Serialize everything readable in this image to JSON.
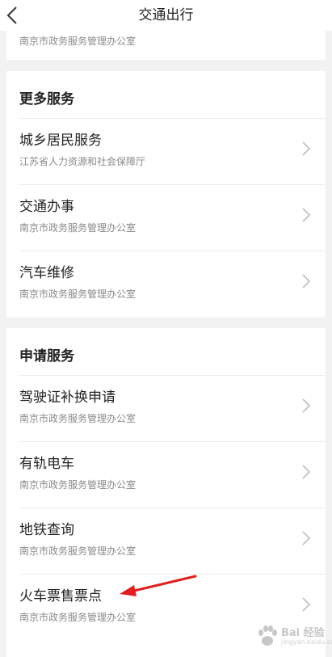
{
  "header": {
    "title": "交通出行",
    "back_icon": "chevron-left-icon"
  },
  "top_partial": {
    "subtitle": "南京市政务服务管理办公室"
  },
  "more_services": {
    "title": "更多服务",
    "items": [
      {
        "name": "城乡居民服务",
        "org": "江苏省人力资源和社会保障厅"
      },
      {
        "name": "交通办事",
        "org": "南京市政务服务管理办公室"
      },
      {
        "name": "汽车维修",
        "org": "南京市政务服务管理办公室"
      }
    ]
  },
  "apply_services": {
    "title": "申请服务",
    "items": [
      {
        "name": "驾驶证补换申请",
        "org": "南京市政务服务管理办公室"
      },
      {
        "name": "有轨电车",
        "org": "南京市政务服务管理办公室"
      },
      {
        "name": "地铁查询",
        "org": "南京市政务服务管理办公室"
      },
      {
        "name": "火车票售票点",
        "org": "南京市政务服务管理办公室"
      }
    ]
  },
  "annotation": {
    "arrow_color": "#e02020",
    "arrow_icon": "red-arrow-icon"
  },
  "watermark": {
    "icon": "paw-icon",
    "text": "Bai 经验",
    "sub": "jingyan.baidu.com"
  }
}
